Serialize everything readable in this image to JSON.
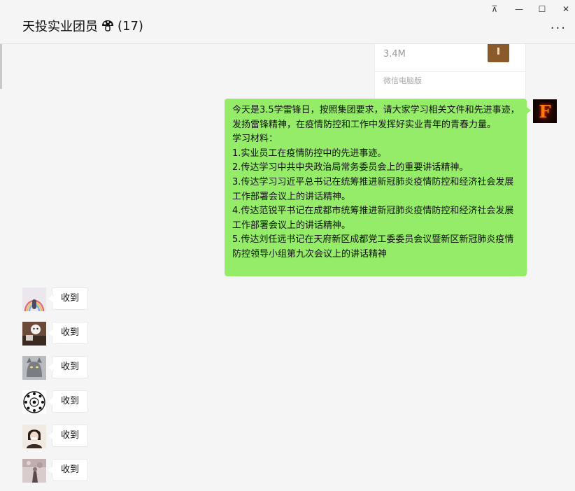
{
  "window": {
    "title": "天投实业团员",
    "member_count": "(17)",
    "controls": {
      "pin": "⊼",
      "minimize": "—",
      "maximize": "☐",
      "close": "✕"
    },
    "more": "···"
  },
  "file_message": {
    "size": "3.4M",
    "source": "微信电脑版"
  },
  "message_right": {
    "lines": [
      "今天是3.5学雷锋日，按照集团要求，请大家学习相关文件和先进事迹，发扬雷锋精神，在疫情防控和工作中发挥好实业青年的青春力量。",
      "学习材料：",
      "1.实业员工在疫情防控中的先进事迹。",
      "2.传达学习中共中央政治局常务委员会上的重要讲话精神。",
      "3.传达学习习近平总书记在统筹推进新冠肺炎疫情防控和经济社会发展工作部署会议上的讲话精神。",
      "4.传达范锐平书记在成都市统筹推进新冠肺炎疫情防控和经济社会发展工作部署会议上的讲话精神。",
      "5.传达刘任远书记在天府新区成都党工委委员会议暨新区新冠肺炎疫情防控领导小组第九次会议上的讲话精神"
    ],
    "avatar_letter": "F"
  },
  "replies": [
    {
      "text": "收到"
    },
    {
      "text": "收到"
    },
    {
      "text": "收到"
    },
    {
      "text": "收到"
    },
    {
      "text": "收到"
    },
    {
      "text": "收到"
    }
  ]
}
